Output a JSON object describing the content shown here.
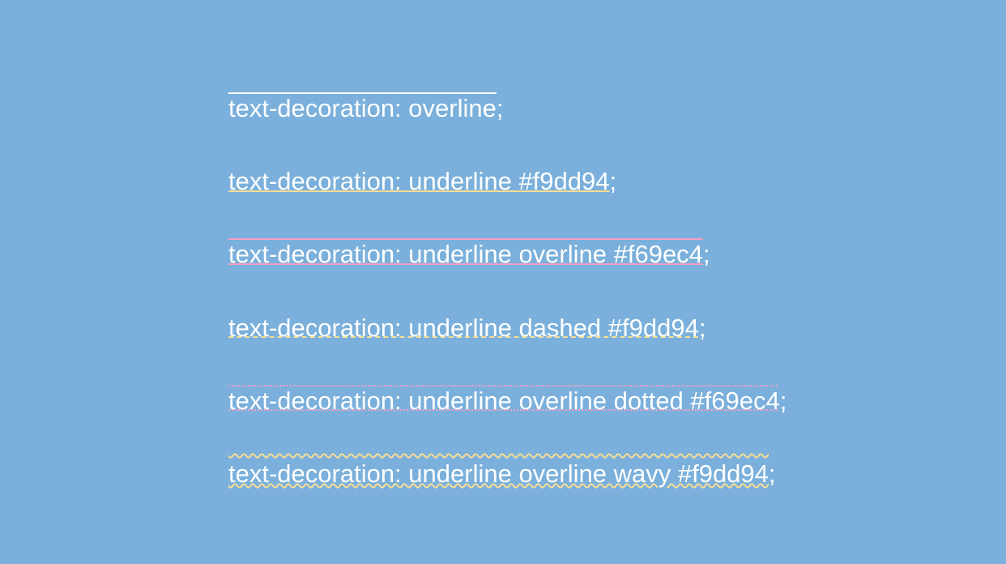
{
  "lines": [
    {
      "text": "text-decoration: overline",
      "semi": ";"
    },
    {
      "text": "text-decoration: underline #f9dd94",
      "semi": ";"
    },
    {
      "text": "text-decoration: underline overline #f69ec4",
      "semi": ";"
    },
    {
      "text": "text-decoration: underline dashed #f9dd94",
      "semi": ";"
    },
    {
      "text": "text-decoration: underline overline dotted #f69ec4",
      "semi": ";"
    },
    {
      "text": "text-decoration: underline overline wavy #f9dd94",
      "semi": ";"
    }
  ]
}
